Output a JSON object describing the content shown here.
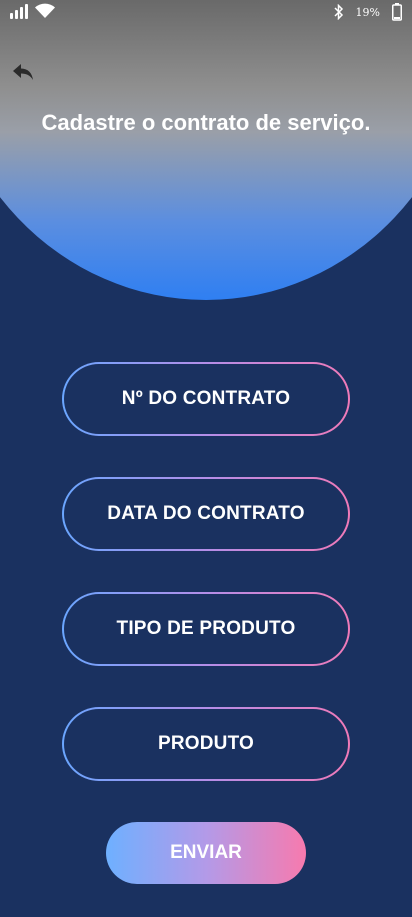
{
  "status_bar": {
    "battery_text": "19%",
    "icons": [
      "signal-icon",
      "wifi-icon",
      "bluetooth-icon",
      "battery-icon"
    ]
  },
  "header": {
    "back_icon": "back-arrow-icon",
    "title": "Cadastre o contrato de serviço."
  },
  "form": {
    "fields": [
      {
        "label": "Nº DO CONTRATO"
      },
      {
        "label": "DATA DO CONTRATO"
      },
      {
        "label": "TIPO DE PRODUTO"
      },
      {
        "label": "PRODUTO"
      }
    ],
    "submit_label": "ENVIAR"
  },
  "colors": {
    "background": "#1a3160",
    "dome_top": "#5a5a5a",
    "dome_bottom": "#2f7ff2",
    "gradient_start": "#6aa6ff",
    "gradient_end": "#f07ab8"
  }
}
